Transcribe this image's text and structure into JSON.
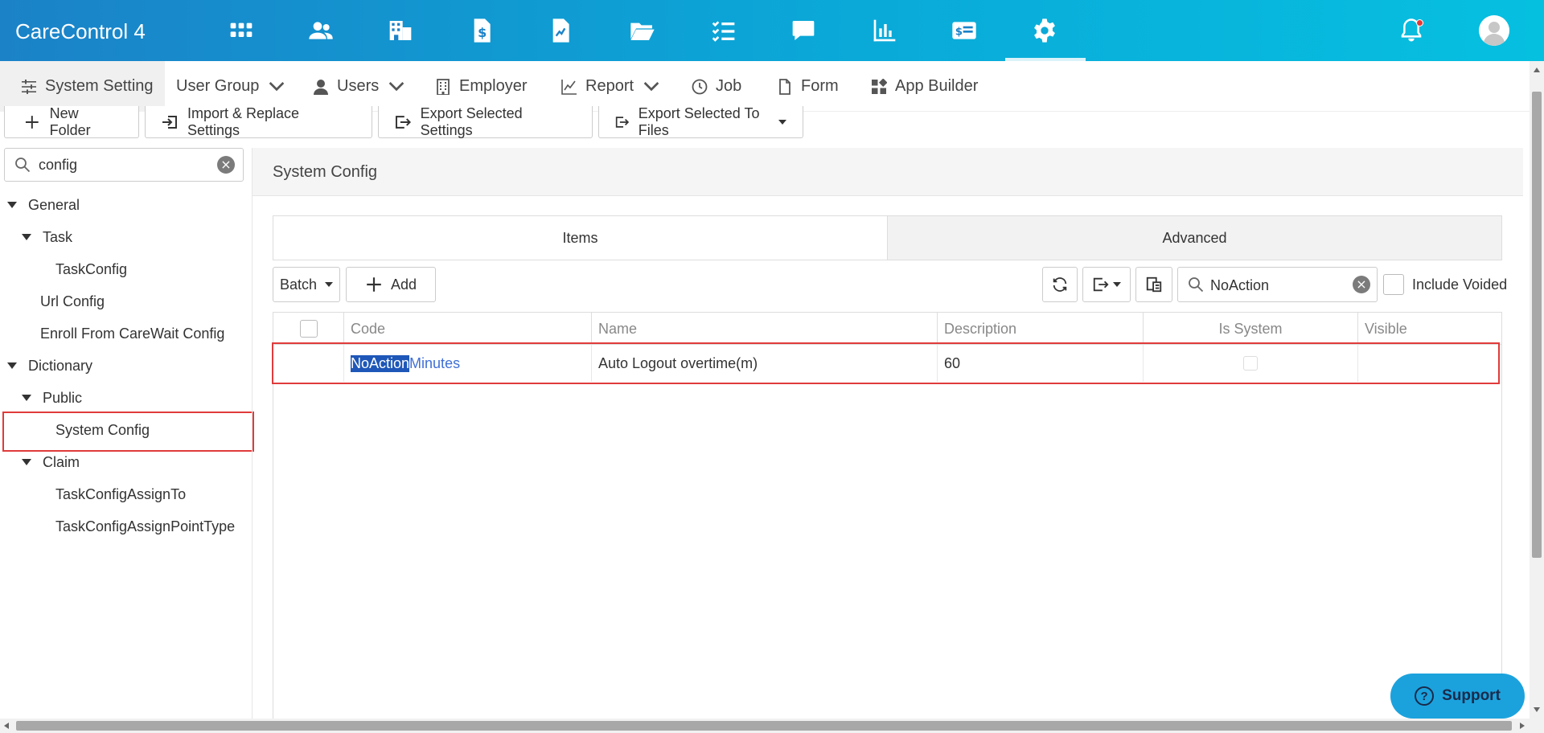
{
  "app": {
    "title": "CareControl 4"
  },
  "topnav": {
    "icons": [
      "apps-grid-icon",
      "users-icon",
      "buildings-icon",
      "invoice-dollar-icon",
      "document-chart-icon",
      "folder-open-icon",
      "task-list-icon",
      "chat-icon",
      "bar-chart-icon",
      "id-card-icon",
      "settings-gear-icon"
    ],
    "active": "settings-gear-icon"
  },
  "subnav": {
    "system_setting": "System Setting",
    "user_group": "User Group",
    "users": "Users",
    "employer": "Employer",
    "report": "Report",
    "job": "Job",
    "form": "Form",
    "app_builder": "App Builder"
  },
  "toolbar": {
    "new_folder": "New Folder",
    "import_replace": "Import & Replace Settings",
    "export_selected": "Export Selected Settings",
    "export_files": "Export Selected To Files"
  },
  "left": {
    "search_value": "config",
    "tree": {
      "general": "General",
      "task": "Task",
      "taskconfig": "TaskConfig",
      "url_config": "Url Config",
      "enroll": "Enroll From CareWait Config",
      "dictionary": "Dictionary",
      "public": "Public",
      "system_config": "System Config",
      "claim": "Claim",
      "assign_to": "TaskConfigAssignTo",
      "assign_point": "TaskConfigAssignPointType"
    },
    "selected": "System Config"
  },
  "panel": {
    "title": "System Config",
    "tabs": {
      "items": "Items",
      "advanced": "Advanced"
    },
    "active_tab": "Items",
    "batch": "Batch",
    "add": "Add",
    "search_value": "NoAction",
    "include_voided": "Include Voided"
  },
  "grid": {
    "columns": {
      "code": "Code",
      "name": "Name",
      "description": "Description",
      "is_system": "Is System",
      "visible": "Visible"
    },
    "rows": [
      {
        "code_match": "NoAction",
        "code_rest": "Minutes",
        "name": "Auto Logout overtime(m)",
        "description": "60"
      }
    ]
  },
  "support": {
    "label": "Support"
  },
  "colors": {
    "topbar_start": "#1b82c8",
    "topbar_end": "#06c0e0",
    "highlight_border": "#e03b3b",
    "link": "#3f6fd6",
    "selection": "#1e57b8"
  }
}
